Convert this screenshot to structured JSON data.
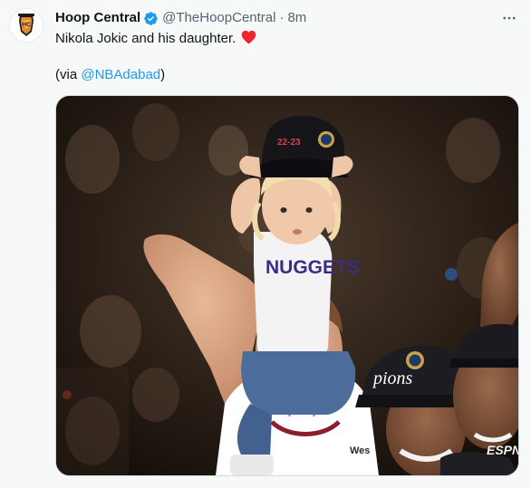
{
  "author": {
    "display_name": "Hoop Central",
    "handle": "@TheHoopCentral",
    "separator": "·",
    "time": "8m",
    "verified": true,
    "avatar_icon": "hoop-central-logo",
    "avatar_initials": "HC"
  },
  "menu": {
    "icon": "more-dots-icon"
  },
  "tweet": {
    "text": "Nikola Jokic and his daughter.",
    "emoji": "red-heart",
    "via_open": "(via ",
    "via_mention": "@NBAdabad",
    "via_close": ")"
  },
  "media": {
    "type": "photo",
    "shirt_text": "NUGGETS",
    "cap_text": "22-23",
    "side_cap_text": "pions",
    "jersey_text": "Wes",
    "watermark": "ESPN"
  },
  "colors": {
    "link": "#1d9bf0",
    "verified": "#1d9bf0",
    "heart": "#f4212e",
    "secondary_text": "#536471",
    "background": "#f7f9f9"
  }
}
